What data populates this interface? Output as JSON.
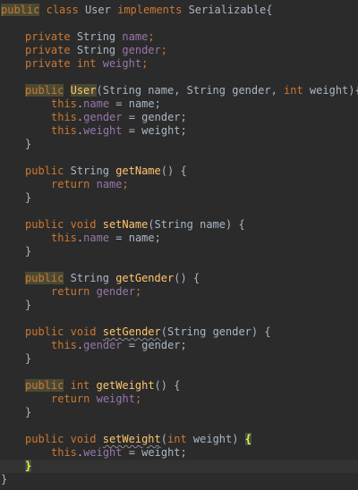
{
  "code": {
    "class_decl": {
      "kw_public": "public",
      "kw_class": "class",
      "name": "User",
      "kw_implements": "implements",
      "iface": "Serializable",
      "brace": "{"
    },
    "field_name": {
      "kw": "private",
      "type": "String",
      "name": "name",
      "semi": ";"
    },
    "field_gender": {
      "kw": "private",
      "type": "String",
      "name": "gender",
      "semi": ";"
    },
    "field_weight": {
      "kw": "private",
      "type": "int",
      "name": "weight",
      "semi": ";"
    },
    "ctor": {
      "kw_public": "public",
      "name": "User",
      "params_open": "(String name, String gender, ",
      "kw_int": "int",
      "params_close": " weight){"
    },
    "ctor_body": [
      {
        "this": "this",
        "dot": ".",
        "field": "name",
        "rest": " = name;"
      },
      {
        "this": "this",
        "dot": ".",
        "field": "gender",
        "rest": " = gender;"
      },
      {
        "this": "this",
        "dot": ".",
        "field": "weight",
        "rest": " = weight;"
      }
    ],
    "close_brace": "}",
    "get_name": {
      "kw_public": "public",
      "type": "String",
      "name": "getName",
      "sig": "() {",
      "ret": "return",
      "field": "name",
      "semi": ";"
    },
    "set_name": {
      "kw_public": "public",
      "kw_void": "void",
      "name": "setName",
      "sig": "(String name) {",
      "this": "this",
      "dot": ".",
      "field": "name",
      "rest": " = name;"
    },
    "get_gender": {
      "kw_public": "public",
      "type": "String",
      "name": "getGender",
      "sig": "() {",
      "ret": "return",
      "field": "gender",
      "semi": ";"
    },
    "set_gender": {
      "kw_public": "public",
      "kw_void": "void",
      "name": "setGender",
      "sig": "(String gender) {",
      "this": "this",
      "dot": ".",
      "field": "gender",
      "rest": " = gender;"
    },
    "get_weight": {
      "kw_public": "public",
      "kw_int": "int",
      "name": "getWeight",
      "sig": "() {",
      "ret": "return",
      "field": "weight",
      "semi": ";"
    },
    "set_weight": {
      "kw_public": "public",
      "kw_void": "void",
      "name": "setWeight",
      "paren": "(",
      "kw_int": "int",
      "sig": " weight) ",
      "open_brace": "{",
      "this": "this",
      "dot": ".",
      "field": "weight",
      "rest": " = weight;"
    }
  },
  "colors": {
    "background": "#2b2b2b",
    "keyword": "#cc7832",
    "method": "#ffc66d",
    "field": "#9876aa",
    "text": "#a9b7c6",
    "brace_match": "#ffef28"
  }
}
